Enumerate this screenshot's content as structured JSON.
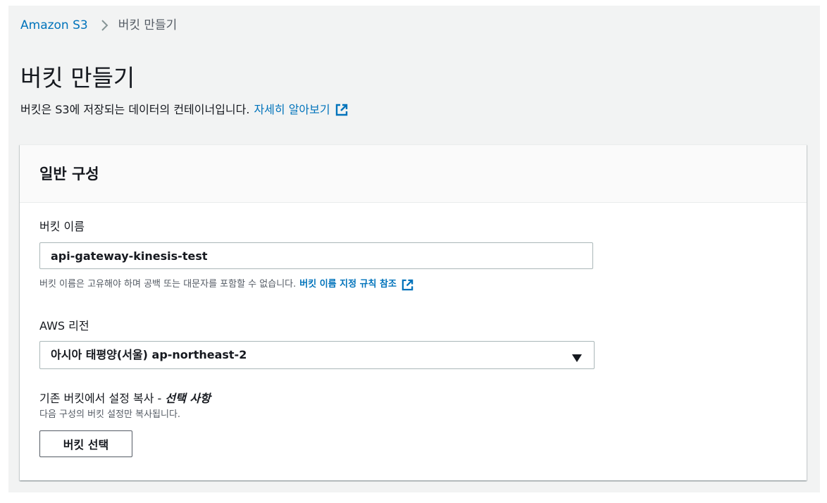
{
  "breadcrumb": {
    "root": "Amazon S3",
    "current": "버킷 만들기"
  },
  "page": {
    "title": "버킷 만들기",
    "description": "버킷은 S3에 저장되는 데이터의 컨테이너입니다.",
    "learn_more": "자세히 알아보기"
  },
  "general": {
    "title": "일반 구성",
    "bucket_name_label": "버킷 이름",
    "bucket_name_value": "api-gateway-kinesis-test",
    "bucket_name_hint": "버킷 이름은 고유해야 하며 공백 또는 대문자를 포함할 수 없습니다.",
    "bucket_name_rules_link": "버킷 이름 지정 규칙 참조",
    "region_label": "AWS 리전",
    "region_value": "아시아 태평양(서울) ap-northeast-2",
    "copy_label": "기존 버킷에서 설정 복사 - ",
    "copy_optional": "선택 사항",
    "copy_hint": "다음 구성의 버킷 설정만 복사됩니다.",
    "choose_bucket_button": "버킷 선택"
  },
  "icons": {
    "breadcrumb_separator": "chevron-right-icon",
    "external_link": "external-link-icon",
    "select_caret": "caret-down-icon"
  },
  "colors": {
    "link": "#0073bb",
    "page_background": "#f2f3f3",
    "text": "#16191f",
    "muted_text": "#545b64"
  }
}
